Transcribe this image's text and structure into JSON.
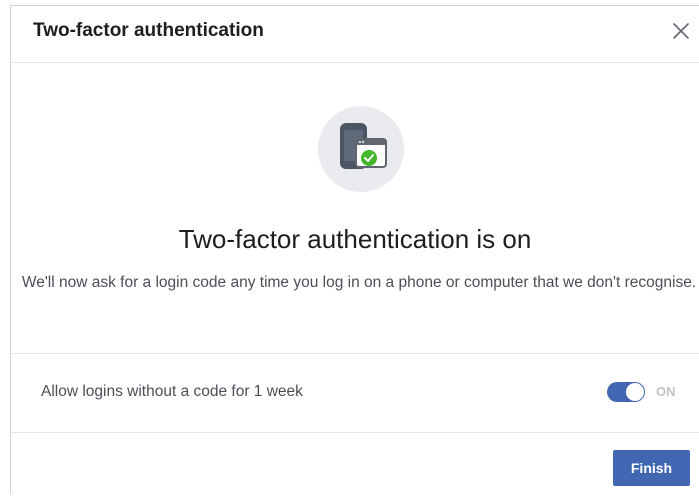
{
  "dialog": {
    "title": "Two-factor authentication",
    "close_icon": "close-icon"
  },
  "body": {
    "illustration_icon": "phone-laptop-check-icon",
    "headline": "Two-factor authentication is on",
    "description": "We'll now ask for a login code any time you log in on a phone or computer that we don't recognise."
  },
  "setting": {
    "label": "Allow logins without a code for 1 week",
    "toggle_state": "ON",
    "toggle_on": true
  },
  "footer": {
    "finish_label": "Finish"
  },
  "colors": {
    "accent": "#4267b2",
    "success": "#42b72a",
    "text_primary": "#1c1e21",
    "text_secondary": "#4b4f56",
    "toggle_text": "#bec3c9"
  }
}
